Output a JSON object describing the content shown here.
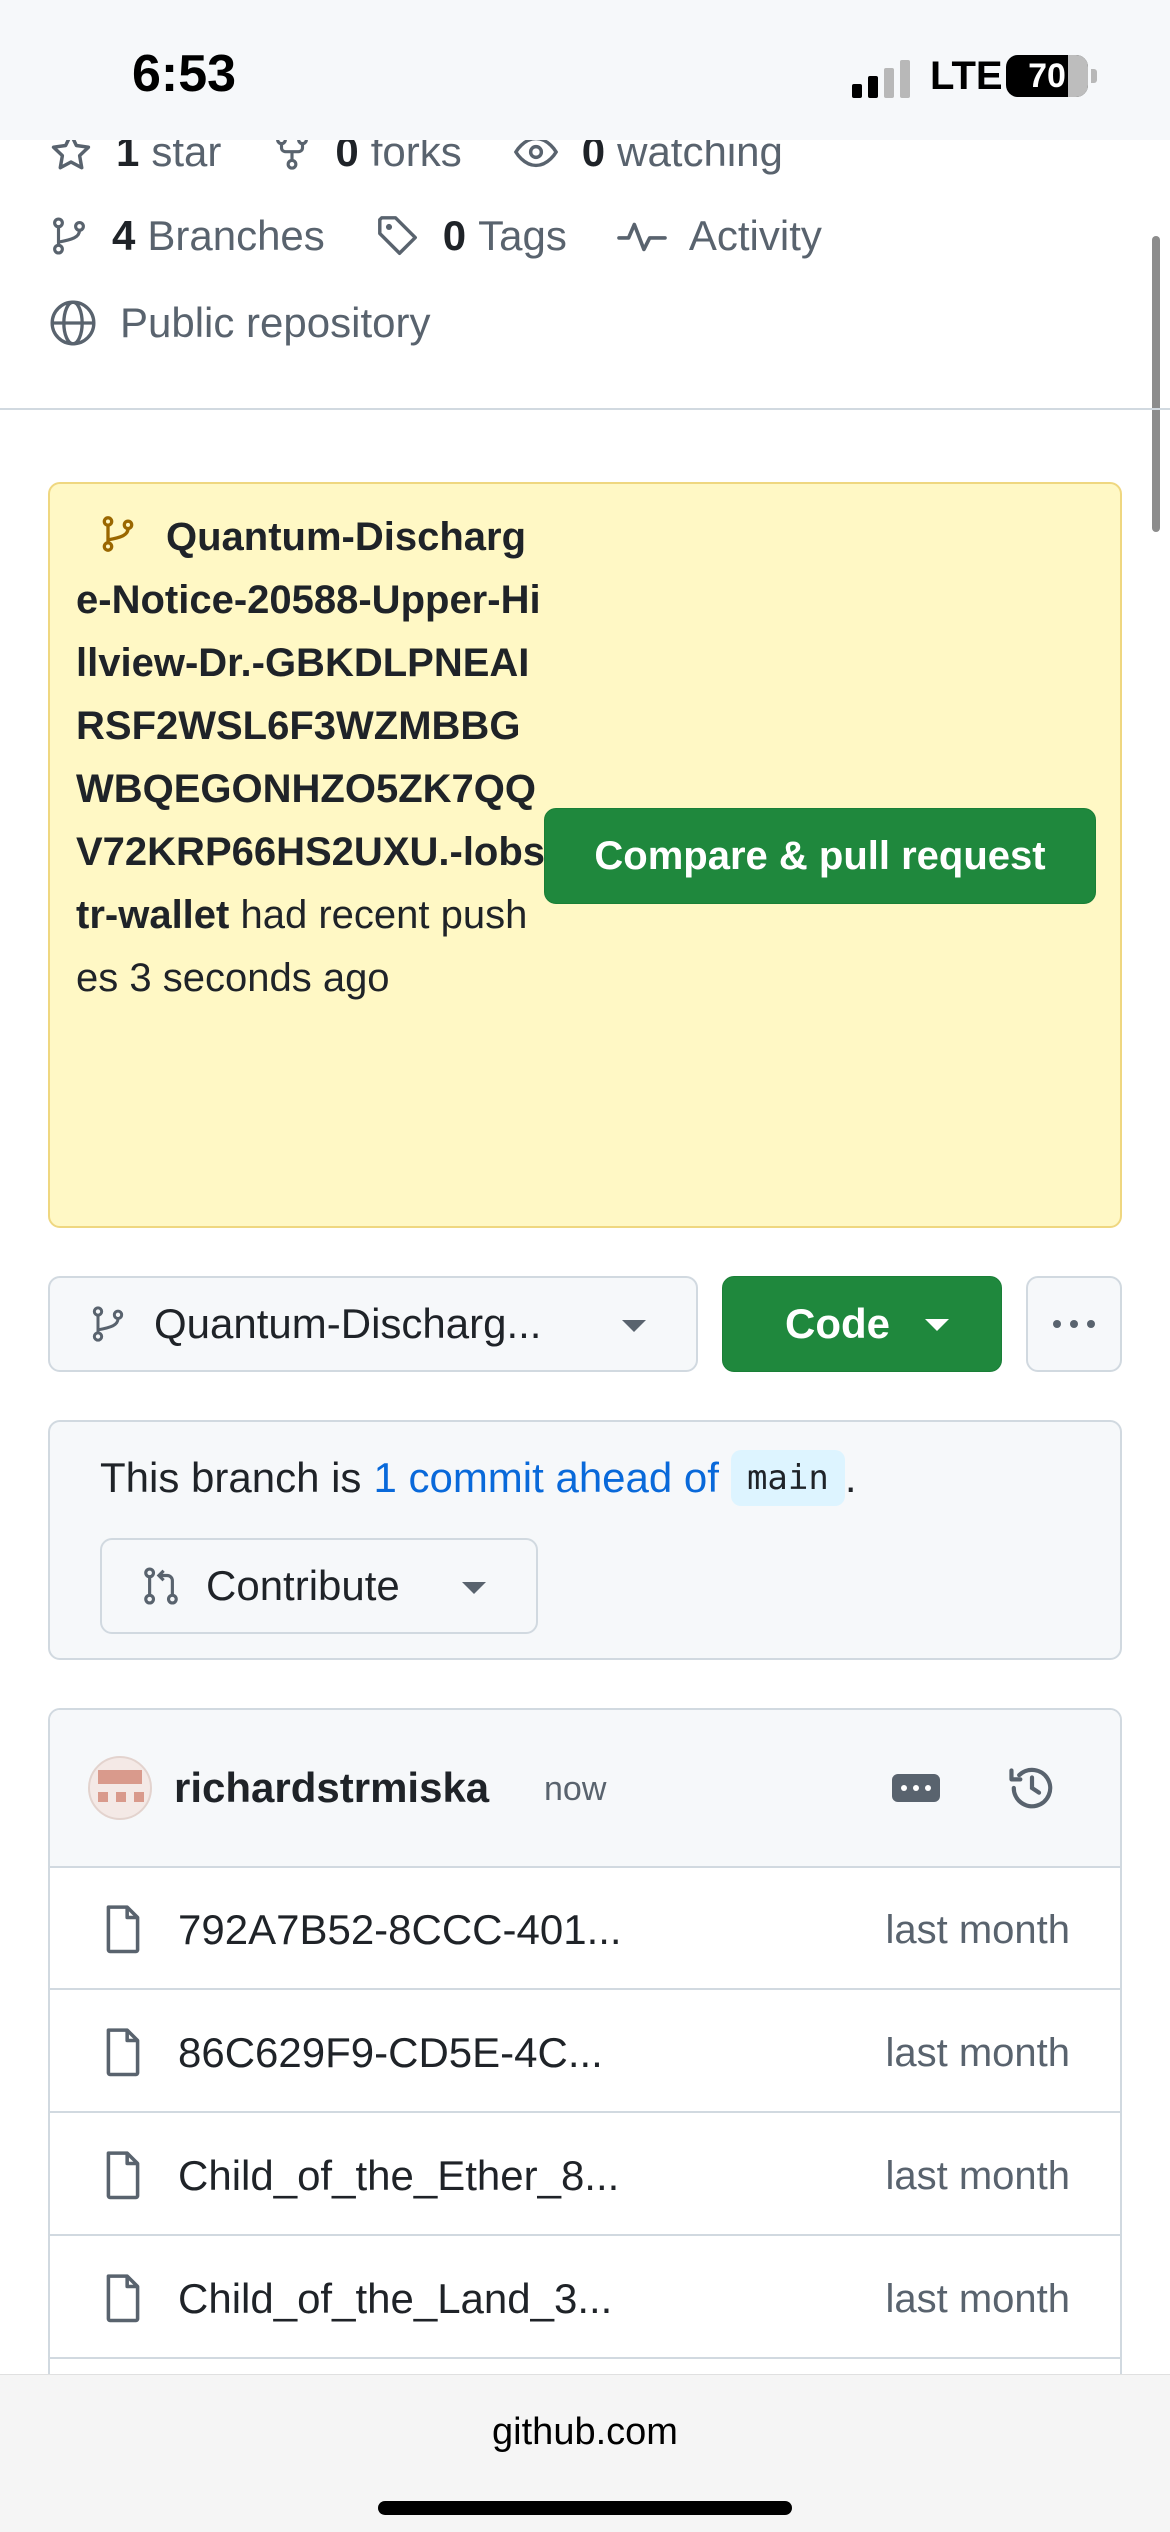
{
  "status_bar": {
    "time": "6:53",
    "network": "LTE",
    "battery": "70"
  },
  "repo_meta": {
    "stars_count": "1",
    "stars_label": "star",
    "forks_count": "0",
    "forks_label": "forks",
    "watching_count": "0",
    "watching_label": "watching",
    "branches_count": "4",
    "branches_label": "Branches",
    "tags_count": "0",
    "tags_label": "Tags",
    "activity_label": "Activity",
    "visibility_label": "Public repository"
  },
  "push_banner": {
    "branch_name": "Quantum-Discharge-Notice-20588-Upper-Hillview-Dr.-GBKDLPNEAIRSF2WSL6F3WZMBBGWBQEGONHZO5ZK7QQV72KRP66HS2UXU.-lobstr-wallet",
    "message": " had recent pushes 3 seconds ago",
    "compare_button": "Compare & pull request"
  },
  "branch_bar": {
    "selected_branch": "Quantum-Discharg...",
    "code_button": "Code"
  },
  "branch_status": {
    "prefix": "This branch is",
    "link": "1 commit ahead of",
    "base_branch": "main",
    "suffix": ".",
    "contribute_button": "Contribute"
  },
  "latest_commit": {
    "author": "richardstrmiska",
    "time": "now"
  },
  "files": [
    {
      "name": "792A7B52-8CCC-401...",
      "date": "last month"
    },
    {
      "name": "86C629F9-CD5E-4C...",
      "date": "last month"
    },
    {
      "name": "Child_of_the_Ether_8...",
      "date": "last month"
    },
    {
      "name": "Child_of_the_Land_3...",
      "date": "last month"
    }
  ],
  "browser": {
    "url": "github.com"
  }
}
